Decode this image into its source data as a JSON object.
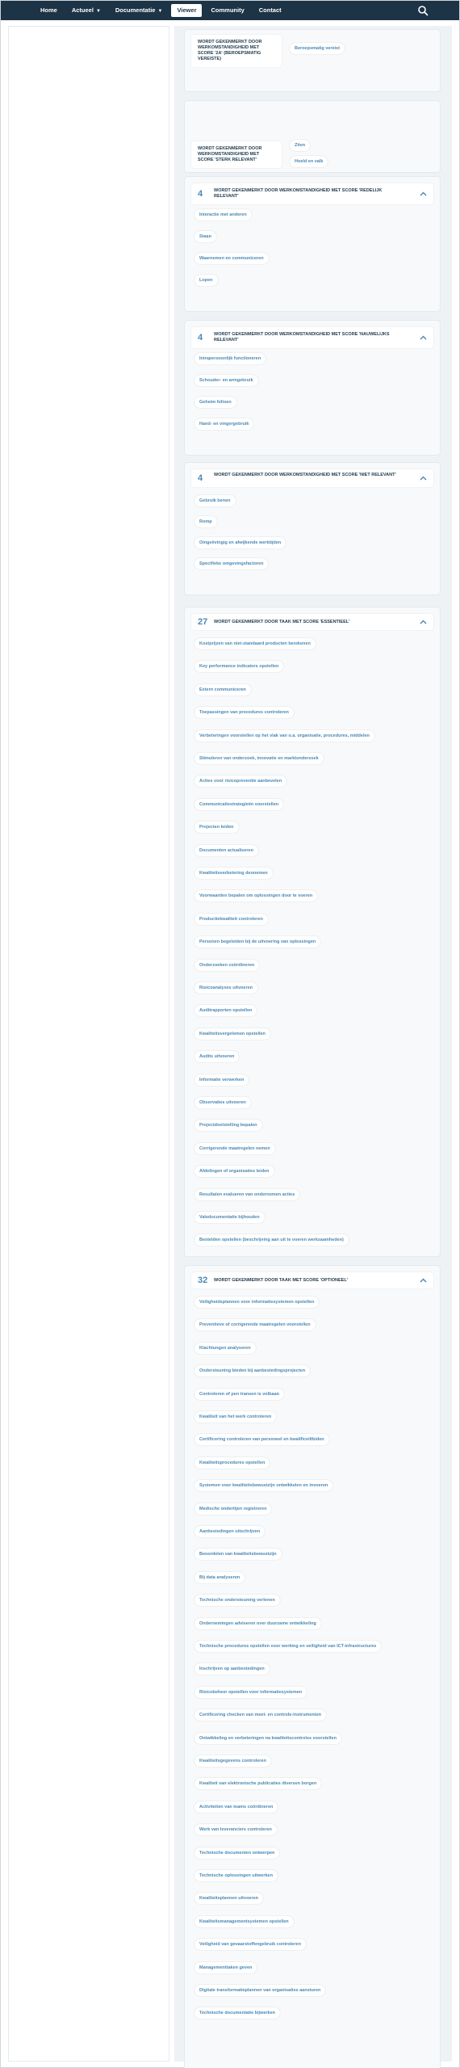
{
  "nav": {
    "items": [
      "Home",
      "Actueel",
      "Documentatie",
      "Viewer",
      "Community",
      "Contact"
    ],
    "active": "Viewer"
  },
  "score_cards": [
    {
      "label": "WORDT GEKENMERKT DOOR WERKOMSTANDIGHEID MET SCORE '2A' (BEROEPSMATIG VEREISTE)",
      "values": [
        "Beroepsmatig vereist"
      ]
    },
    {
      "label": "WORDT GEKENMERKT DOOR WERKOMSTANDIGHEID MET SCORE 'STERK RELEVANT'",
      "values": [
        "Ziten",
        "Hoeld en valk"
      ]
    }
  ],
  "groups": [
    {
      "count": "4",
      "title": "WORDT GEKENMERKT DOOR WERKOMSTANDIGHEID MET SCORE 'REDELIJK RELEVANT'",
      "items": [
        "Interactie met anderen",
        "Staan",
        "Waarnemen en communiceren",
        "Lopen"
      ]
    },
    {
      "count": "4",
      "title": "WORDT GEKENMERKT DOOR WERKOMSTANDIGHEID MET SCORE 'NAUWELIJKS RELEVANT'",
      "items": [
        "Intrapersoonlijk functioneren",
        "Schouder- en armgebruik",
        "Geheim folloen",
        "Hand- en vingergebruik"
      ]
    },
    {
      "count": "4",
      "title": "WORDT GEKENMERKT DOOR WERKOMSTANDIGHEID MET SCORE 'NIET RELEVANT'",
      "items": [
        "Gebruik benen",
        "Romp",
        "Omgeëvingig en afwijkende werktijden",
        "Specifieke omgevingsfactoren"
      ]
    },
    {
      "count": "27",
      "title": "WORDT GEKENMERKT DOOR TAAK MET SCORE 'ESSENTIEEL'",
      "items": [
        "Kostprijzen van niet-standaard producten berekenen",
        "Key performance indicators opstellen",
        "Extern communiceren",
        "Toepassingen van procedures controleren",
        "Verbeteringen voorstellen op het vlak van o.a. organisatie, procedures, middelen",
        "Stimuleren van onderzoek, innovatie en marktonderzoek",
        "Acties voor risicopreventie aanbevelen",
        "Communicatiestrategieën voorstellen",
        "Projecten leiden",
        "Documenten actualiseren",
        "Kwaliteitsverbetering deonemen",
        "Voorwaarden bepalen om oplossingen door te voeren",
        "Productiekwaliteit controleren",
        "Personen begeleiden bij de uitvoering van oplossingen",
        "Onderzoeken coördineren",
        "Risicoanalyses uitvoeren",
        "Auditrapporten opstellen",
        "Kwaliteitsvergelemen opstellen",
        "Audits uitvoeren",
        "Informatie verwerken",
        "Observaties uitvoeren",
        "Projectdoelstelling bepalen",
        "Corrigerende maatregelen nemen",
        "Afdelingen of organisaties leiden",
        "Resultaten evalueren van ondernomen acties",
        "Valedocumentatie bijhouden",
        "Bestelden opstellen (beschrijving aan uit te voeren werkzaamheden)"
      ]
    },
    {
      "count": "32",
      "title": "WORDT GEKENMERKT DOOR TAAK MET SCORE 'OPTIONEEL'",
      "items": [
        "Veiligheidsplannen voor informatiesystemen opstellen",
        "Preventieve of corrigerende maatregelen voorstellen",
        "Klachtungen analyseren",
        "Ondersteuning bieden bij aanbestedingsprojecten",
        "Controleren of pen transen is volbaan",
        "Kwaliteit van het werk controleren",
        "Certificering controleren van personeel en kwalificeiltbiden",
        "Kwaliteitsprocedures opstellen",
        "Systemen voor kwaliteitsbewustzijn ontwikkelen en invoeren",
        "Medische ondertijen registreren",
        "Aanbestedingen uitschrijven",
        "Beoordelen van kwaliteitsbewustzijn",
        "Bij data analyseren",
        "Technische ondersteuning verlenen",
        "Ondernemingen adviseren over duurzame ontwikkeling",
        "Technische procedures opstellen voor werking en veiligheid van ICT-infrastructures",
        "Inschrijven op aanbestedingen",
        "Risicobeheer opstellen voor informatiesystemen",
        "Certificering checken van meet- en controle-instrumenten",
        "Ontwikkeling en verbeteringen na kwaliteitscontroles voorstellen",
        "Kwaliteitsgegevens controleren",
        "Kwaliteit van elektronische publicaties diversen borgen",
        "Activiteiten van teams coördineren",
        "Werk van leveranciers controleren",
        "Technische documenten ontwerpen",
        "Technische oplossingen uitwerken",
        "Kwaliteitsplannen uitvoeren",
        "Kwaliteitsmanagementsystemen opstellen",
        "Veiligheid van gevaarstoffengebruik controleren",
        "Managementtaken geven",
        "Digitale transformatieplannen van organisaties aansturen",
        "Technische documentatie bijwerken"
      ]
    }
  ]
}
